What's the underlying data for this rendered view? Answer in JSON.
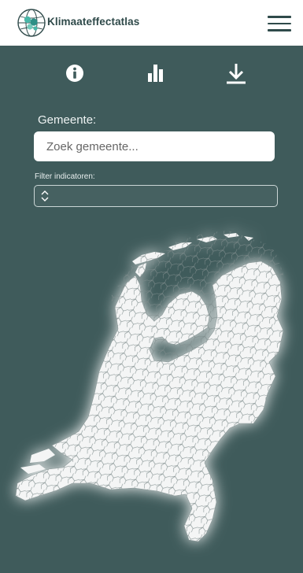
{
  "header": {
    "brand": "Klimaateffectatlas",
    "logo_icon": "globe-logo-icon",
    "menu_icon": "hamburger-menu-icon"
  },
  "toolbar": {
    "icons": [
      "info-icon",
      "bar-chart-icon",
      "download-icon"
    ]
  },
  "filters": {
    "municipality_label": "Gemeente:",
    "municipality_placeholder": "Zoek gemeente...",
    "indicator_label": "Filter indicatoren:",
    "indicator_value": ""
  },
  "map": {
    "region": "Nederland",
    "land_color": "#f4f5f5",
    "border_color": "#7a8a8a"
  },
  "colors": {
    "panel": "#3f5b5b",
    "header_bg": "#ffffff",
    "brand": "#2f4a4a"
  }
}
